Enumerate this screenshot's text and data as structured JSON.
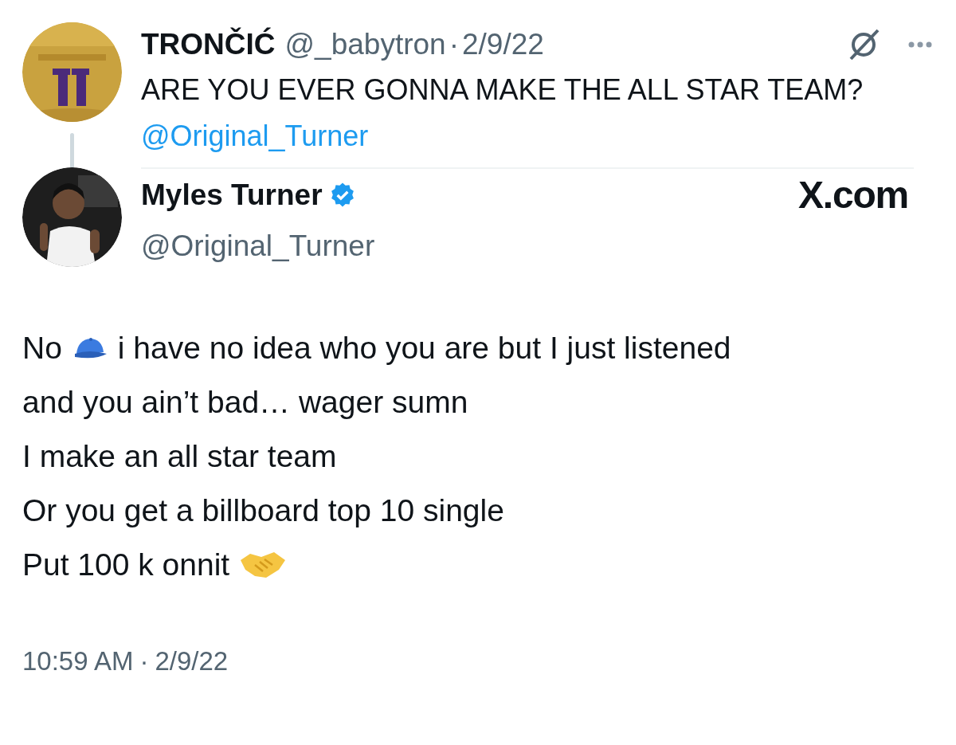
{
  "parent_tweet": {
    "name": "TRONČIĆ",
    "handle": "@_babytron",
    "separator": "·",
    "date": "2/9/22",
    "text": "ARE YOU EVER GONNA MAKE THE ALL STAR TEAM?",
    "mention": "@Original_Turner"
  },
  "tweet": {
    "name": "Myles Turner",
    "verified": true,
    "handle": "@Original_Turner",
    "logo": "X.com",
    "lines": [
      {
        "parts": [
          {
            "kind": "text",
            "text": "No"
          },
          {
            "kind": "cap"
          },
          {
            "kind": "text",
            "text": "i have no idea who you are but I just listened"
          }
        ]
      },
      {
        "parts": [
          {
            "kind": "text",
            "text": "and you ain’t bad… wager sumn"
          }
        ]
      },
      {
        "parts": [
          {
            "kind": "text",
            "text": "I make an all star team"
          }
        ]
      },
      {
        "parts": [
          {
            "kind": "text",
            "text": "Or you get a billboard top 10 single"
          }
        ]
      },
      {
        "parts": [
          {
            "kind": "text",
            "text": "Put 100 k onnit"
          },
          {
            "kind": "handshake"
          }
        ]
      }
    ],
    "time": "10:59 AM",
    "separator": "·",
    "date": "2/9/22"
  }
}
